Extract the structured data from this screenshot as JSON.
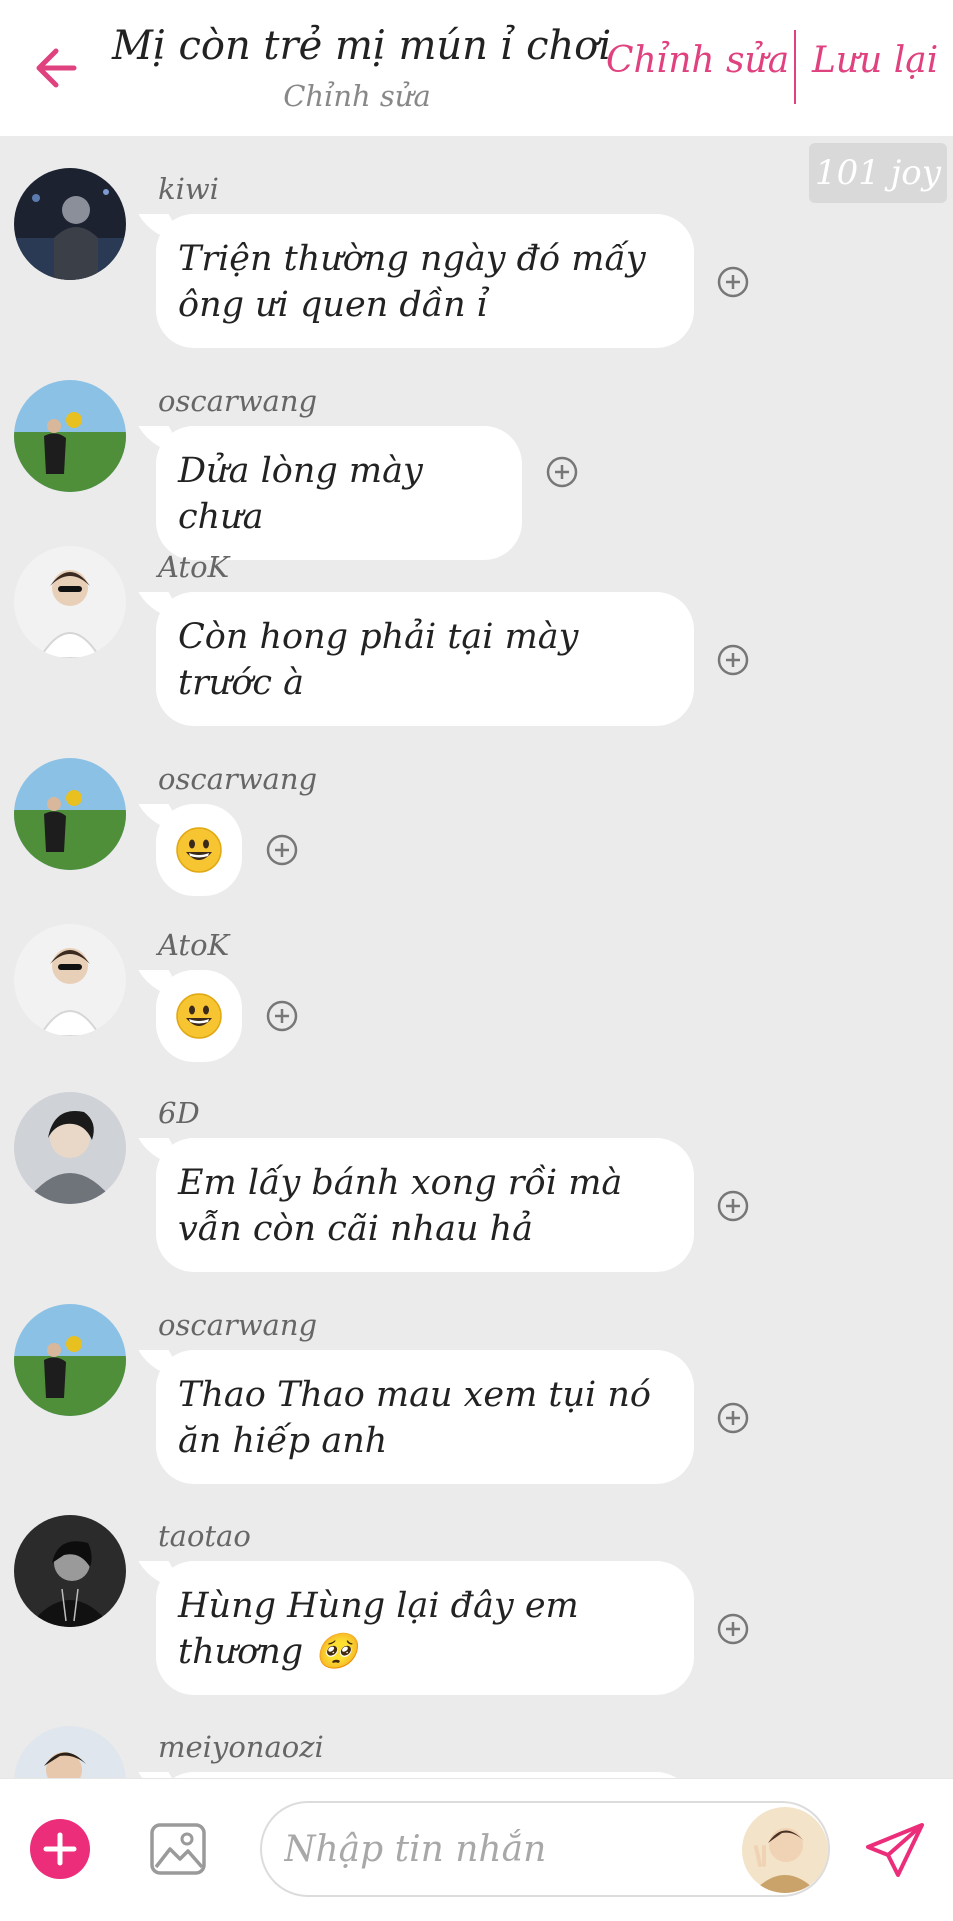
{
  "header": {
    "title": "Mị còn trẻ mị mún ỉ chơi",
    "subtitle": "Chỉnh sửa",
    "edit_label": "Chỉnh sửa",
    "save_label": "Lưu lại",
    "accent_color": "#e0427f"
  },
  "watermark": "101 joy",
  "messages": [
    {
      "user": "kiwi",
      "text": "Triện thường ngày đó mấy ông ưi quen dần ỉ",
      "avatar": "avatar-kiwi"
    },
    {
      "user": "oscarwang",
      "text": "Dửa lòng mày chưa",
      "avatar": "avatar-oscarwang"
    },
    {
      "user": "AtoK",
      "text": "Còn hong phải tại mày trước à",
      "avatar": "avatar-atok"
    },
    {
      "user": "oscarwang",
      "text": "😀",
      "avatar": "avatar-oscarwang"
    },
    {
      "user": "AtoK",
      "text": "😀",
      "avatar": "avatar-atok"
    },
    {
      "user": "6D",
      "text": "Em lấy bánh xong rồi mà vẫn còn cãi nhau hả",
      "avatar": "avatar-6d"
    },
    {
      "user": "oscarwang",
      "text": "Thao Thao mau xem tụi nó ăn hiếp anh",
      "avatar": "avatar-oscarwang"
    },
    {
      "user": "taotao",
      "text": "Hùng Hùng lại đây em thương 🥺",
      "avatar": "avatar-taotao"
    },
    {
      "user": "meiyonaozi",
      "text": "",
      "avatar": "avatar-meiyonaozi"
    }
  ],
  "composer": {
    "placeholder": "Nhập tin nhắn",
    "add_icon": "plus-icon",
    "image_icon": "image-icon",
    "send_icon": "send-icon",
    "accent_color": "#ec2d7a"
  }
}
